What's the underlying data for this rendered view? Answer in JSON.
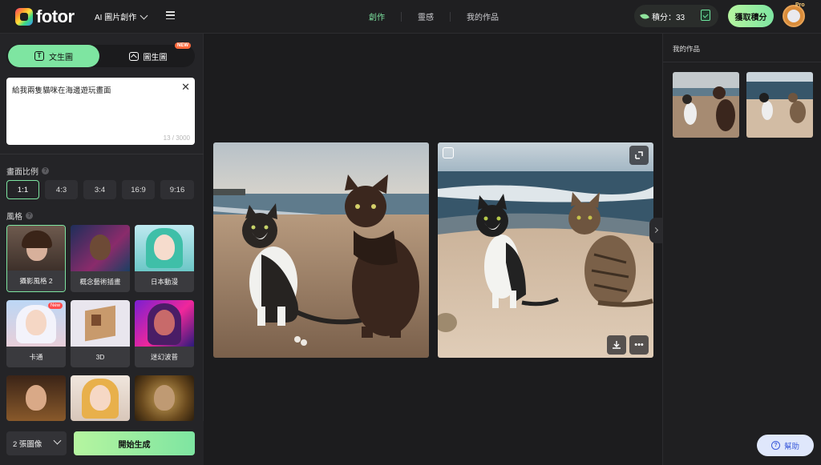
{
  "header": {
    "logo_text": "fotor",
    "ai_menu_label": "AI 圖片創作",
    "nav": [
      {
        "label": "創作",
        "active": true
      },
      {
        "label": "靈感",
        "active": false
      },
      {
        "label": "我的作品",
        "active": false
      }
    ],
    "credits_label": "積分：33",
    "get_credits_label": "獲取積分",
    "pro_badge": "Pro"
  },
  "left_panel": {
    "tabs": [
      {
        "label": "文生圖",
        "active": true
      },
      {
        "label": "圖生圖",
        "active": false
      }
    ],
    "new_badge": "NEW",
    "prompt": {
      "value": "給我兩隻貓咪在海邊遊玩畫面",
      "count": "13 / 3000"
    },
    "ratio_label": "畫面比例",
    "ratios": [
      "1:1",
      "4:3",
      "3:4",
      "16:9",
      "9:16"
    ],
    "selected_ratio": "1:1",
    "style_label": "風格",
    "styles": [
      {
        "label": "攝影風格 2",
        "active": true
      },
      {
        "label": "概念藝術插畫",
        "active": false
      },
      {
        "label": "日本動漫",
        "active": false
      },
      {
        "label": "卡通",
        "active": false,
        "badge": "New"
      },
      {
        "label": "3D",
        "active": false
      },
      {
        "label": "迷幻波普",
        "active": false
      }
    ],
    "image_count": "2 張圖像",
    "generate_label": "開始生成"
  },
  "right_panel": {
    "title": "我的作品"
  },
  "help_label": "幫助",
  "colors": {
    "accent": "#7ee5a1",
    "background": "#1c1c1e",
    "panel": "#242427"
  },
  "icons": {
    "download": "download-icon",
    "more": "more-icon",
    "expand": "expand-icon",
    "close": "close-icon"
  }
}
